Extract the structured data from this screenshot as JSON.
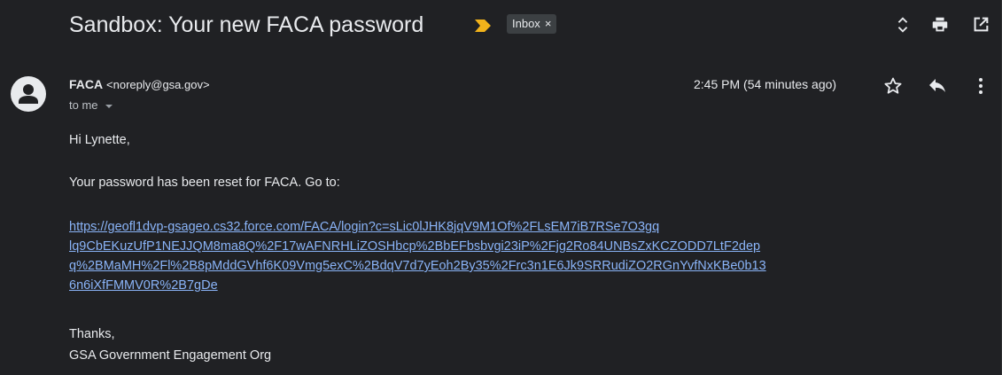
{
  "email": {
    "subject": "Sandbox: Your new FACA password",
    "label_chip": {
      "label": "Inbox",
      "close_symbol": "×"
    },
    "sender": {
      "name": "FACA",
      "email": "<noreply@gsa.gov>"
    },
    "recipient_line": "to me",
    "timestamp": "2:45 PM (54 minutes ago)",
    "body": {
      "greeting": "Hi Lynette,",
      "paragraph": "Your password has been reset for FACA. Go to:",
      "link_lines": [
        "https://geofl1dvp-gsageo.cs32.force.com/FACA/login?c=sLic0lJHK8jqV9M1Of%2FLsEM7iB7RSe7O3gq",
        "lq9CbEKuzUfP1NEJJQM8ma8Q%2F17wAFNRHLiZOSHbcp%2BbEFbsbvgi23iP%2Fjg2Ro84UNBsZxKCZODD7LtF2dep",
        "q%2BMaMH%2Fl%2B8pMddGVhf6K09Vmg5exC%2BdqV7d7yEoh2By35%2Frc3n1E6Jk9SRRudiZO2RGnYvfNxKBe0b13",
        "6n6iXfFMMV0R%2B7gDe"
      ],
      "closing": "Thanks,",
      "signature": "GSA Government Engagement Org"
    }
  },
  "icons": {
    "importance": "importance-marker-icon",
    "expand": "unfold-icon",
    "print": "print-icon",
    "popout": "open-in-new-window-icon",
    "avatar": "person-icon",
    "star": "star-icon",
    "reply": "reply-icon",
    "more": "more-vertical-icon"
  },
  "colors": {
    "background": "#202124",
    "text": "#e8eaed",
    "link": "#8ab4f8",
    "importance": "#f2b31b",
    "chip": "#3c4043"
  }
}
